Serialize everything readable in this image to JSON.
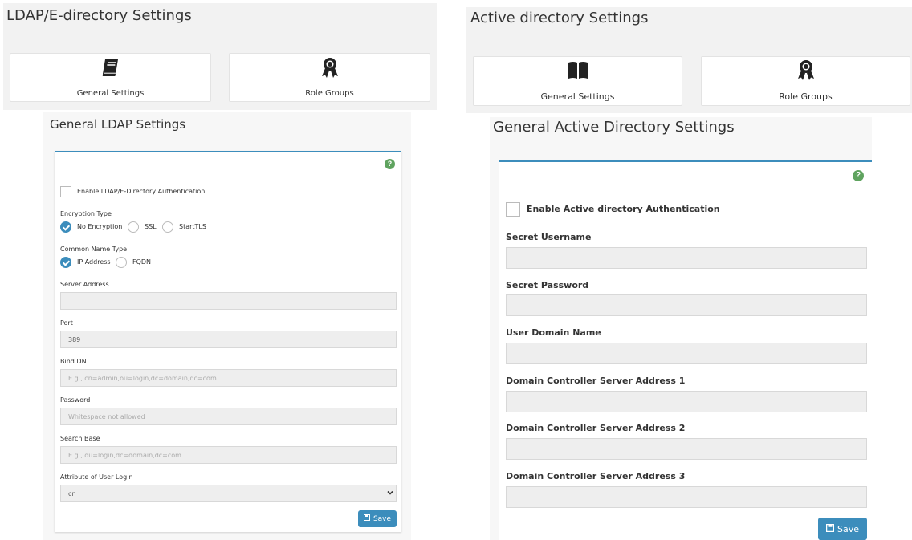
{
  "left": {
    "header_title": "LDAP/E-directory Settings",
    "tabs": [
      {
        "label": "General Settings",
        "icon": "book-icon"
      },
      {
        "label": "Role Groups",
        "icon": "ribbon-award-icon"
      }
    ],
    "section_title": "General LDAP Settings",
    "help": "?",
    "enable_label": "Enable LDAP/E-Directory Authentication",
    "encryption": {
      "label": "Encryption Type",
      "options": [
        "No Encryption",
        "SSL",
        "StartTLS"
      ],
      "selected": "No Encryption"
    },
    "common_name": {
      "label": "Common Name Type",
      "options": [
        "IP Address",
        "FQDN"
      ],
      "selected": "IP Address"
    },
    "fields": {
      "server_address": {
        "label": "Server Address",
        "value": "",
        "placeholder": ""
      },
      "port": {
        "label": "Port",
        "value": "389"
      },
      "bind_dn": {
        "label": "Bind DN",
        "placeholder": "E.g., cn=admin,ou=login,dc=domain,dc=com"
      },
      "password": {
        "label": "Password",
        "placeholder": "Whitespace not allowed"
      },
      "search_base": {
        "label": "Search Base",
        "placeholder": "E.g., ou=login,dc=domain,dc=com"
      },
      "user_login_attr": {
        "label": "Attribute of User Login",
        "value": "cn"
      }
    },
    "save_label": "Save"
  },
  "right": {
    "header_title": "Active directory Settings",
    "tabs": [
      {
        "label": "General Settings",
        "icon": "open-book-icon"
      },
      {
        "label": "Role Groups",
        "icon": "ribbon-award-icon"
      }
    ],
    "section_title": "General Active Directory Settings",
    "help": "?",
    "enable_label": "Enable Active directory Authentication",
    "fields": [
      {
        "label": "Secret Username",
        "value": ""
      },
      {
        "label": "Secret Password",
        "value": ""
      },
      {
        "label": "User Domain Name",
        "value": ""
      },
      {
        "label": "Domain Controller Server Address 1",
        "value": ""
      },
      {
        "label": "Domain Controller Server Address 2",
        "value": ""
      },
      {
        "label": "Domain Controller Server Address 3",
        "value": ""
      }
    ],
    "save_label": "Save"
  },
  "colors": {
    "accent": "#3c8dbc",
    "help": "#5fa35f",
    "panel_bg": "#f2f2f2"
  }
}
